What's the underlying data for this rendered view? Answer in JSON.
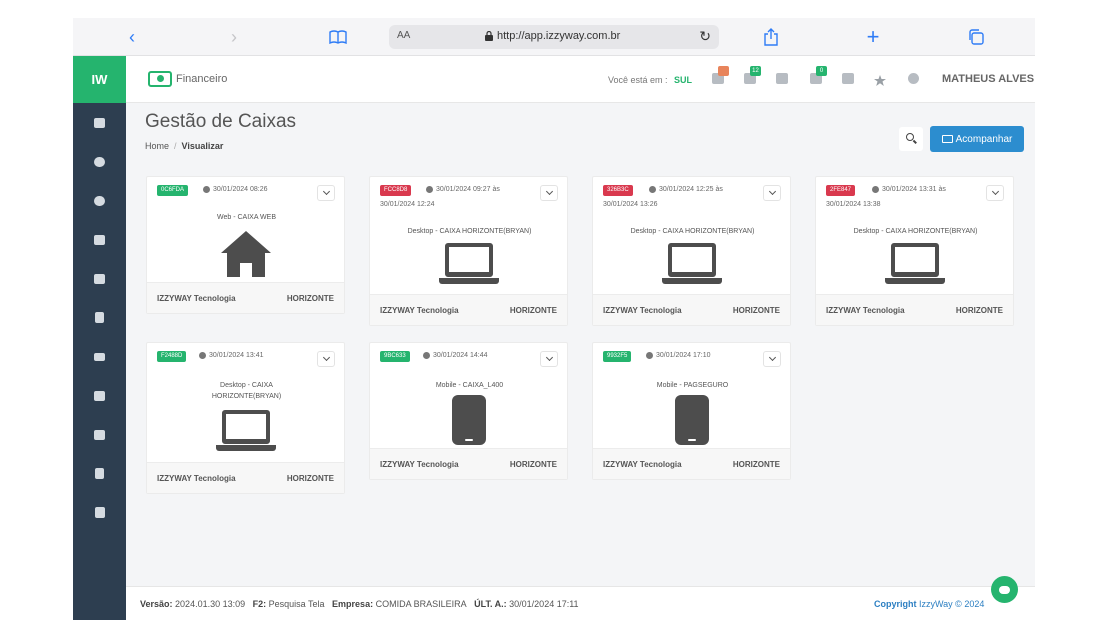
{
  "browser": {
    "url_aa": "AA",
    "url": "http://app.izzyway.com.br"
  },
  "sidebar": {
    "logo": "IW",
    "items": [
      "chart-icon",
      "cloud-upload-icon",
      "cloud-download-icon",
      "card-icon",
      "chart-icon",
      "calculator-icon",
      "list-icon",
      "building-icon",
      "card-icon",
      "file-icon",
      "copy-icon"
    ]
  },
  "topbar": {
    "module": "Financeiro",
    "location_label": "Você está em :",
    "location_value": "SUL",
    "badges": [
      {
        "value": "",
        "color": "#e8845b"
      },
      {
        "value": "12",
        "color": "#25b46e"
      },
      {
        "value": "0",
        "color": "#25b46e"
      }
    ],
    "user": "MATHEUS ALVES"
  },
  "page": {
    "title": "Gestão de Caixas",
    "breadcrumb_home": "Home",
    "breadcrumb_current": "Visualizar",
    "follow_button": "Acompanhar"
  },
  "cards": [
    {
      "tag": "0C6FDA",
      "tag_color": "green",
      "date1": "30/01/2024 08:26",
      "date2": "",
      "title": "Web - CAIXA WEB",
      "icon": "house-icon",
      "company": "IZZYWAY Tecnologia",
      "unit": "HORIZONTE"
    },
    {
      "tag": "FCC8D8",
      "tag_color": "red",
      "date1": "30/01/2024 09:27 às",
      "date2": "30/01/2024 12:24",
      "title": "Desktop - CAIXA HORIZONTE(BRYAN)",
      "icon": "laptop-icon",
      "company": "IZZYWAY Tecnologia",
      "unit": "HORIZONTE"
    },
    {
      "tag": "326B3C",
      "tag_color": "red",
      "date1": "30/01/2024 12:25 às",
      "date2": "30/01/2024 13:26",
      "title": "Desktop - CAIXA HORIZONTE(BRYAN)",
      "icon": "laptop-icon",
      "company": "IZZYWAY Tecnologia",
      "unit": "HORIZONTE"
    },
    {
      "tag": "2FE847",
      "tag_color": "red",
      "date1": "30/01/2024 13:31 às",
      "date2": "30/01/2024 13:38",
      "title": "Desktop - CAIXA HORIZONTE(BRYAN)",
      "icon": "laptop-icon",
      "company": "IZZYWAY Tecnologia",
      "unit": "HORIZONTE"
    },
    {
      "tag": "F2488D",
      "tag_color": "green",
      "date1": "30/01/2024 13:41",
      "date2": "",
      "title": "Desktop - CAIXA HORIZONTE(BRYAN)",
      "icon": "laptop-icon",
      "company": "IZZYWAY Tecnologia",
      "unit": "HORIZONTE"
    },
    {
      "tag": "9BC633",
      "tag_color": "green",
      "date1": "30/01/2024 14:44",
      "date2": "",
      "title": "Mobile - CAIXA_L400",
      "icon": "phone-icon",
      "company": "IZZYWAY Tecnologia",
      "unit": "HORIZONTE"
    },
    {
      "tag": "9932F5",
      "tag_color": "green",
      "date1": "30/01/2024 17:10",
      "date2": "",
      "title": "Mobile - PAGSEGURO",
      "icon": "phone-icon",
      "company": "IZZYWAY Tecnologia",
      "unit": "HORIZONTE"
    }
  ],
  "footer": {
    "version_label": "Versão:",
    "version_value": "2024.01.30 13:09",
    "f2_label": "F2:",
    "f2_value": "Pesquisa Tela",
    "company_label": "Empresa:",
    "company_value": "COMIDA BRASILEIRA",
    "last_label": "ÚLT. A.:",
    "last_value": "30/01/2024 17:11",
    "copyright_brand": "Copyright",
    "copyright_rest": "IzzyWay © 2024"
  }
}
